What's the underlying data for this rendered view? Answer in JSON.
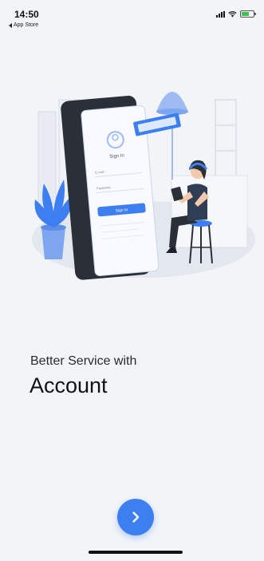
{
  "status_bar": {
    "time": "14:50",
    "back_label": "App Store",
    "battery_color": "#3cc24a"
  },
  "illustration": {
    "screen_title": "Sign In",
    "field_labels": [
      "E-mail",
      "Password"
    ],
    "button_label": "Sign In",
    "icon": "signin-illustration"
  },
  "onboarding": {
    "subtitle": "Better Service with",
    "title": "Account"
  },
  "next_button": {
    "icon": "chevron-right-icon",
    "color": "#3d7ff0"
  }
}
